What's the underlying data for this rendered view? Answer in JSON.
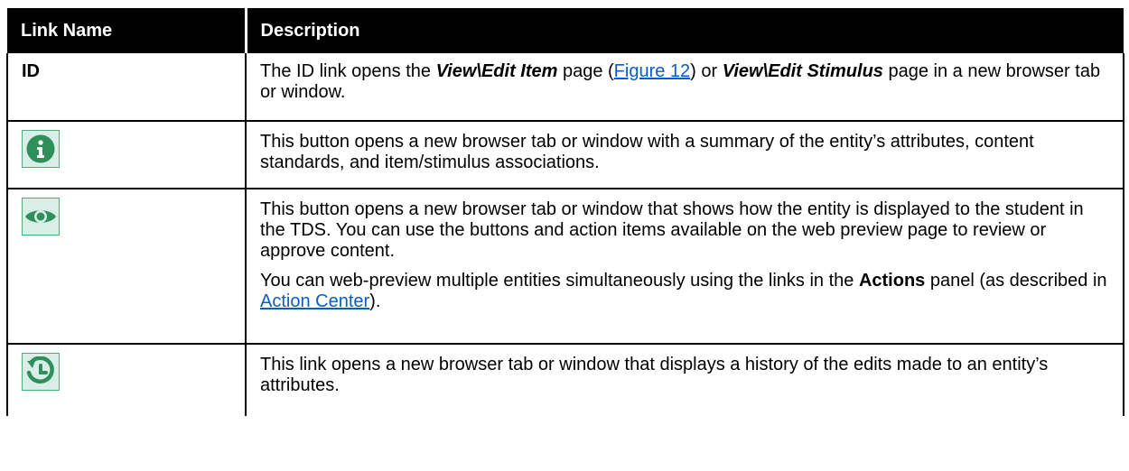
{
  "header": {
    "col1": "Link Name",
    "col2": "Description"
  },
  "rows": [
    {
      "name": "ID",
      "desc_a": "The ID link opens the ",
      "em1": "View\\Edit Item",
      "desc_b": " page (",
      "link1": "Figure 12",
      "desc_c": ") or ",
      "em2": "View\\Edit Stimulus",
      "desc_d": " page in a new browser tab or window."
    },
    {
      "icon": "info-icon",
      "desc": "This button opens a new browser tab or window with a summary of the entity’s attributes, content standards, and item/stimulus associations."
    },
    {
      "icon": "eye-icon",
      "desc1": "This button opens a new browser tab or window that shows how the entity is displayed to the student in the TDS. You can use the buttons and action items available on the web preview page to review or approve content.",
      "desc2_a": "You can web-preview multiple entities simultaneously using the links in the ",
      "desc2_bold": "Actions",
      "desc2_b": " panel (as described in ",
      "desc2_link": "Action Center",
      "desc2_c": ")."
    },
    {
      "icon": "history-icon",
      "desc": "This link opens a new browser tab or window that displays a history of the edits made to an entity’s attributes."
    }
  ],
  "colors": {
    "header_bg": "#000000",
    "icon_green": "#2f8f5b",
    "icon_bg": "#d9eee7",
    "link": "#0b5cc6"
  }
}
